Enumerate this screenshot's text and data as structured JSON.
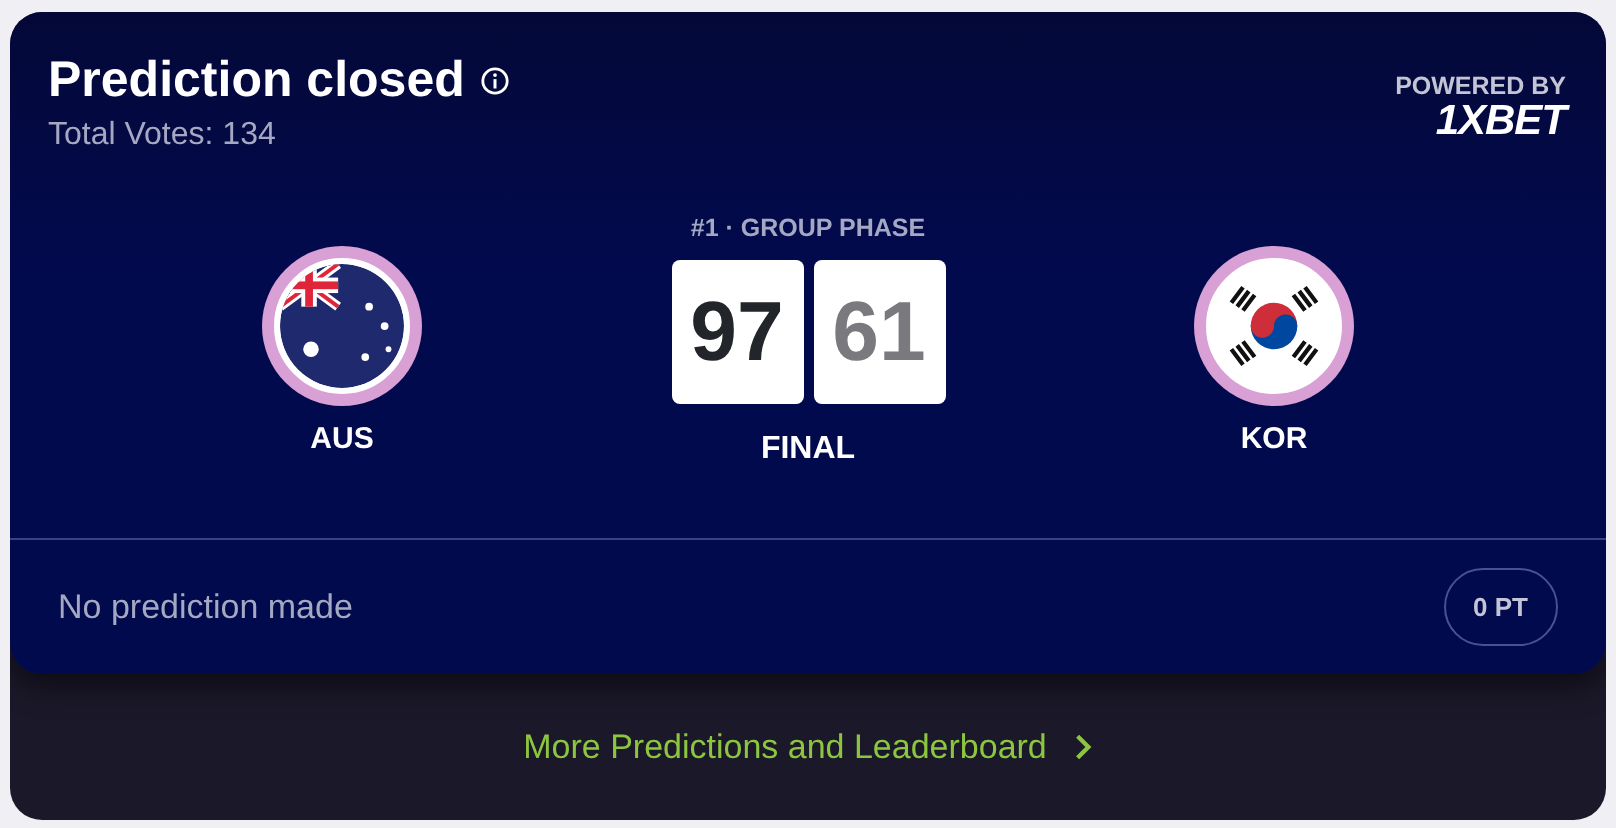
{
  "header": {
    "title": "Prediction closed",
    "total_votes": "Total Votes: 134",
    "powered_by": "POWERED BY",
    "sponsor": "1XBET"
  },
  "match": {
    "phase": "#1 · GROUP PHASE",
    "status": "FINAL",
    "home": {
      "code": "AUS",
      "kind": "aus",
      "score": "97",
      "winner": true
    },
    "away": {
      "code": "KOR",
      "kind": "kor",
      "score": "61",
      "winner": false
    }
  },
  "prediction": {
    "text": "No prediction made",
    "points": "0 PT"
  },
  "footer": {
    "link": "More Predictions and Leaderboard"
  }
}
